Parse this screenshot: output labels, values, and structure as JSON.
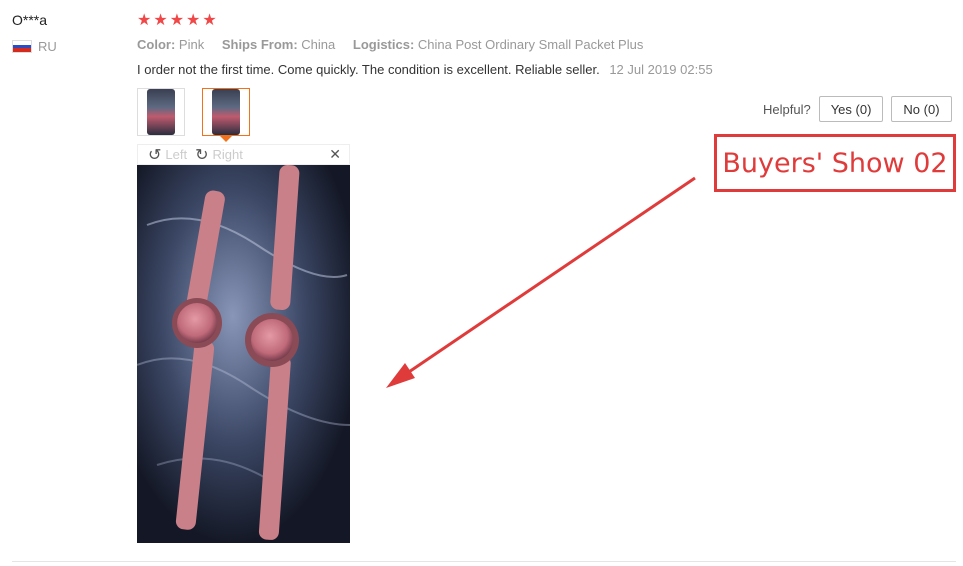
{
  "user": {
    "name": "O***a",
    "country": "RU"
  },
  "rating": {
    "stars": 5,
    "max": 5,
    "star_color": "#f04848"
  },
  "attributes": [
    {
      "key": "Color:",
      "value": "Pink"
    },
    {
      "key": "Ships From:",
      "value": "China"
    },
    {
      "key": "Logistics:",
      "value": "China Post Ordinary Small Packet Plus"
    }
  ],
  "review": {
    "text": "I order not the first time. Come quickly. The condition is excellent. Reliable seller.",
    "date": "12 Jul 2019 02:55"
  },
  "helpful": {
    "label": "Helpful?",
    "yes": "Yes (0)",
    "no": "No (0)"
  },
  "viewer": {
    "rotate_left": "Left",
    "rotate_right": "Right",
    "close_icon": "close-icon",
    "active_thumb_color": "#f2711c"
  },
  "photo": {
    "subject": "two pink-strapped wristwatches"
  },
  "callout": {
    "text": "Buyers' Show 02",
    "color": "#e03b3b"
  }
}
